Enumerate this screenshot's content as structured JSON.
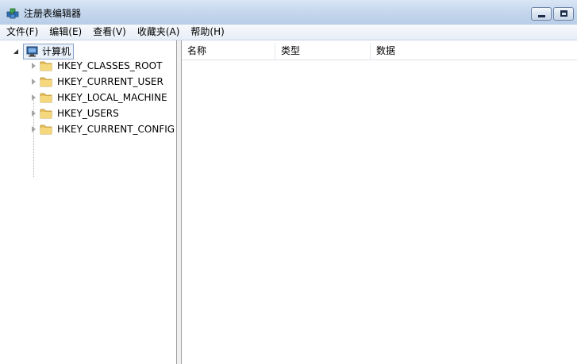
{
  "window": {
    "title": "注册表编辑器",
    "accent": "#c6d8ee"
  },
  "menu": [
    {
      "label": "文件(F)"
    },
    {
      "label": "编辑(E)"
    },
    {
      "label": "查看(V)"
    },
    {
      "label": "收藏夹(A)"
    },
    {
      "label": "帮助(H)"
    }
  ],
  "tree": {
    "root": {
      "label": "计算机",
      "icon": "computer-icon",
      "expanded": true
    },
    "children": [
      {
        "label": "HKEY_CLASSES_ROOT",
        "icon": "folder-icon"
      },
      {
        "label": "HKEY_CURRENT_USER",
        "icon": "folder-icon"
      },
      {
        "label": "HKEY_LOCAL_MACHINE",
        "icon": "folder-icon"
      },
      {
        "label": "HKEY_USERS",
        "icon": "folder-icon"
      },
      {
        "label": "HKEY_CURRENT_CONFIG",
        "icon": "folder-icon"
      }
    ]
  },
  "list": {
    "columns": [
      {
        "label": "名称"
      },
      {
        "label": "类型"
      },
      {
        "label": "数据"
      }
    ]
  }
}
